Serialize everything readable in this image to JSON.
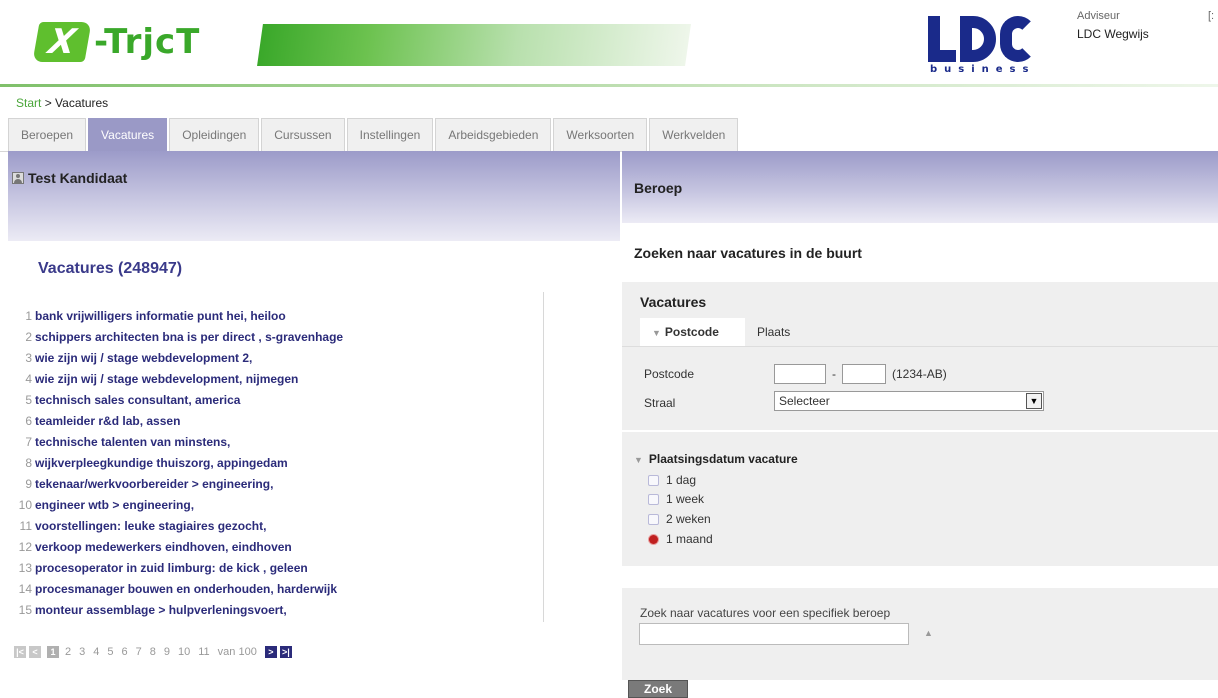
{
  "header": {
    "logo_mark": "X",
    "logo_text": "-TrjcT",
    "ldc_sub": "business",
    "adviseur_label": "Adviseur",
    "adviseur_name": "LDC Wegwijs",
    "corner_icon_text": "[:"
  },
  "breadcrumb": {
    "start": "Start",
    "current": "> Vacatures"
  },
  "tabs": [
    {
      "label": "Beroepen",
      "active": false
    },
    {
      "label": "Vacatures",
      "active": true
    },
    {
      "label": "Opleidingen",
      "active": false
    },
    {
      "label": "Cursussen",
      "active": false
    },
    {
      "label": "Instellingen",
      "active": false
    },
    {
      "label": "Arbeidsgebieden",
      "active": false
    },
    {
      "label": "Werksoorten",
      "active": false
    },
    {
      "label": "Werkvelden",
      "active": false
    }
  ],
  "left": {
    "candidate": "Test Kandidaat",
    "vacatures_title": "Vacatures (248947)",
    "items": [
      {
        "num": "1",
        "text": "bank vrijwilligers informatie punt hei, heiloo"
      },
      {
        "num": "2",
        "text": "schippers architecten bna is per direct , s-gravenhage"
      },
      {
        "num": "3",
        "text": "wie zijn wij / stage webdevelopment 2,"
      },
      {
        "num": "4",
        "text": "wie zijn wij / stage webdevelopment, nijmegen"
      },
      {
        "num": "5",
        "text": "technisch sales consultant, america"
      },
      {
        "num": "6",
        "text": "teamleider r&d lab, assen"
      },
      {
        "num": "7",
        "text": "technische talenten van minstens,"
      },
      {
        "num": "8",
        "text": "wijkverpleegkundige thuiszorg, appingedam"
      },
      {
        "num": "9",
        "text": "tekenaar/werkvoorbereider > engineering,"
      },
      {
        "num": "10",
        "text": "engineer wtb > engineering,"
      },
      {
        "num": "11",
        "text": "voorstellingen: leuke stagiaires gezocht,"
      },
      {
        "num": "12",
        "text": "verkoop medewerkers eindhoven, eindhoven"
      },
      {
        "num": "13",
        "text": "procesoperator in zuid limburg: de kick , geleen"
      },
      {
        "num": "14",
        "text": "procesmanager bouwen en onderhouden, harderwijk"
      },
      {
        "num": "15",
        "text": "monteur assemblage > hulpverleningsvoert,"
      }
    ],
    "pager": {
      "first": "|<",
      "prev": "<",
      "current": "1",
      "pages": [
        "2",
        "3",
        "4",
        "5",
        "6",
        "7",
        "8",
        "9",
        "10",
        "11"
      ],
      "van": "van 100",
      "next": ">",
      "last": ">|"
    }
  },
  "right": {
    "beroep_title": "Beroep",
    "zoeken_title": "Zoeken naar vacatures in de buurt",
    "vacatures_box_title": "Vacatures",
    "subtabs": {
      "postcode": "Postcode",
      "plaats": "Plaats"
    },
    "postcode_label": "Postcode",
    "postcode_dash": "-",
    "postcode_hint": "(1234-AB)",
    "straal_label": "Straal",
    "straal_value": "Selecteer",
    "plaatsingsdatum_title": "Plaatsingsdatum vacature",
    "date_options": [
      {
        "label": "1 dag",
        "selected": false
      },
      {
        "label": "1 week",
        "selected": false
      },
      {
        "label": "2 weken",
        "selected": false
      },
      {
        "label": "1 maand",
        "selected": true
      }
    ],
    "beroep_search_label": "Zoek naar vacatures voor een specifiek beroep",
    "beroep_search_value": "",
    "zoek_button": "Zoek"
  },
  "colors": {
    "brand_green": "#3aa82a",
    "ldc_blue": "#1a2a8a",
    "tab_active": "#9a99c6",
    "link_navy": "#2b2b7a"
  }
}
